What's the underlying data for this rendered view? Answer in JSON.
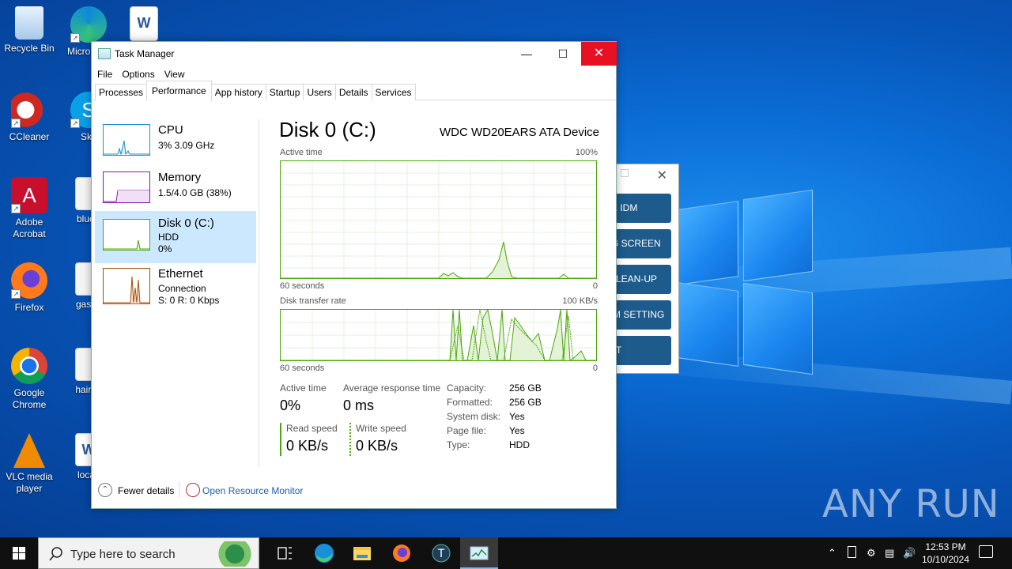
{
  "desktop": {
    "icons": [
      {
        "label": "Recycle Bin"
      },
      {
        "label": "Micro Edg"
      },
      {
        "label": ""
      },
      {
        "label": "CCleaner"
      },
      {
        "label": "Sky"
      },
      {
        "label": "Adobe Acrobat"
      },
      {
        "label": "bluefr"
      },
      {
        "label": "Firefox"
      },
      {
        "label": "gassh"
      },
      {
        "label": "Google Chrome"
      },
      {
        "label": "hairpu"
      },
      {
        "label": "VLC media player"
      },
      {
        "label": "localf"
      }
    ],
    "watermark": "ANY RUN"
  },
  "bg_dialog": {
    "buttons": [
      "E  IDM",
      "G  SCREEN",
      "LEAN-UP",
      "M SETTING",
      "T"
    ]
  },
  "window": {
    "title": "Task Manager",
    "menu": [
      "File",
      "Options",
      "View"
    ],
    "tabs": [
      "Processes",
      "Performance",
      "App history",
      "Startup",
      "Users",
      "Details",
      "Services"
    ],
    "active_tab": "Performance"
  },
  "resources": [
    {
      "name": "CPU",
      "line1": "3% 3.09 GHz",
      "line2": "",
      "color": "#1a8fce"
    },
    {
      "name": "Memory",
      "line1": "1.5/4.0 GB (38%)",
      "line2": "",
      "color": "#8b12ae"
    },
    {
      "name": "Disk 0 (C:)",
      "line1": "HDD",
      "line2": "0%",
      "color": "#4da60c"
    },
    {
      "name": "Ethernet",
      "line1": "Connection",
      "line2": "S: 0 R: 0 Kbps",
      "color": "#a74f01"
    }
  ],
  "disk": {
    "title": "Disk 0 (C:)",
    "device": "WDC WD20EARS ATA Device",
    "graph1": {
      "label": "Active time",
      "max": "100%",
      "xleft": "60 seconds",
      "xright": "0"
    },
    "graph2": {
      "label": "Disk transfer rate",
      "max": "100 KB/s",
      "xleft": "60 seconds",
      "xright": "0"
    },
    "stats": {
      "active_time_label": "Active time",
      "active_time": "0%",
      "avg_resp_label": "Average response time",
      "avg_resp": "0 ms",
      "read_label": "Read speed",
      "read": "0 KB/s",
      "write_label": "Write speed",
      "write": "0 KB/s"
    },
    "props": [
      {
        "k": "Capacity:",
        "v": "256 GB"
      },
      {
        "k": "Formatted:",
        "v": "256 GB"
      },
      {
        "k": "System disk:",
        "v": "Yes"
      },
      {
        "k": "Page file:",
        "v": "Yes"
      },
      {
        "k": "Type:",
        "v": "HDD"
      }
    ]
  },
  "footer": {
    "fewer": "Fewer details",
    "monitor": "Open Resource Monitor"
  },
  "taskbar": {
    "search_placeholder": "Type here to search",
    "time": "12:53 PM",
    "date": "10/10/2024"
  }
}
